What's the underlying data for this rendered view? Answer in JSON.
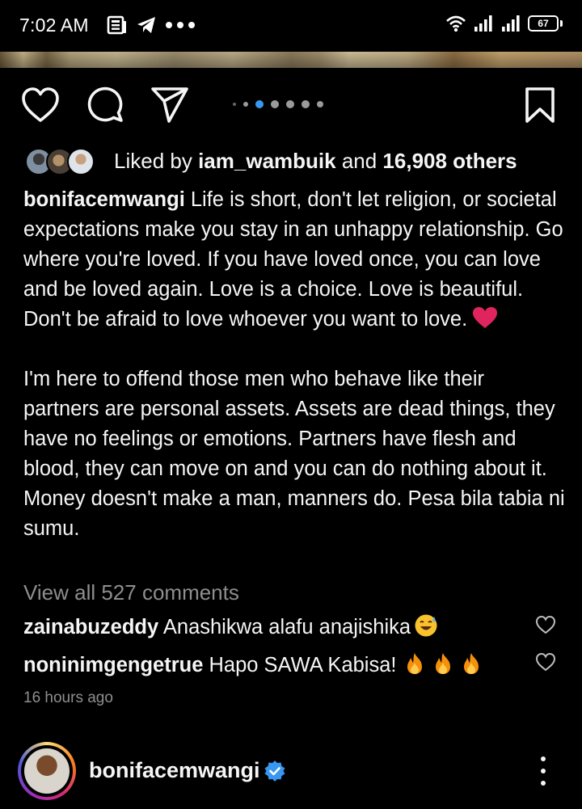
{
  "status_bar": {
    "time": "7:02 AM",
    "battery": "67",
    "icons": [
      "news-icon",
      "telegram-icon",
      "more-dots-icon",
      "wifi-icon",
      "signal-icon",
      "signal-icon",
      "battery-icon"
    ]
  },
  "post": {
    "actions": [
      "like-heart-icon",
      "comment-icon",
      "share-icon",
      "bookmark-icon"
    ],
    "carousel": {
      "count": 7,
      "active_index": 2
    },
    "likes": {
      "prefix": "Liked by ",
      "first_user": "iam_wambuik",
      "middle": " and ",
      "count": "16,908 others"
    },
    "caption": {
      "username": "bonifacemwangi",
      "paragraph1": " Life is short, don't let religion, or societal expectations make you stay in an unhappy relationship. Go where you're loved. If you have loved once, you can love and be loved again. Love is a choice. Love is beautiful. Don't be afraid to love whoever you want to love.",
      "paragraph2": "I'm here to offend those men who behave like their partners are personal assets. Assets are dead things, they have no feelings or emotions. Partners have flesh and blood, they can move on and you can do nothing about it. Money doesn't make a man, manners do. Pesa bila tabia ni sumu."
    },
    "view_comments": "View all 527 comments",
    "comments": [
      {
        "user": "zainabuzeddy",
        "text": " Anashikwa alafu anajishika",
        "emoji": "sweat-smile-emoji"
      },
      {
        "user": "noninimgengetrue",
        "text": " Hapo SAWA Kabisa!",
        "emoji": "fire-emoji x3"
      }
    ],
    "timestamp": "16 hours ago"
  },
  "next_post": {
    "username": "bonifacemwangi",
    "verified": true
  },
  "colors": {
    "background": "#000000",
    "text": "#f5f5f5",
    "muted": "#8e8e8e",
    "active_dot": "#3897f0",
    "verified": "#3897f0",
    "heart": "#e0245e"
  }
}
